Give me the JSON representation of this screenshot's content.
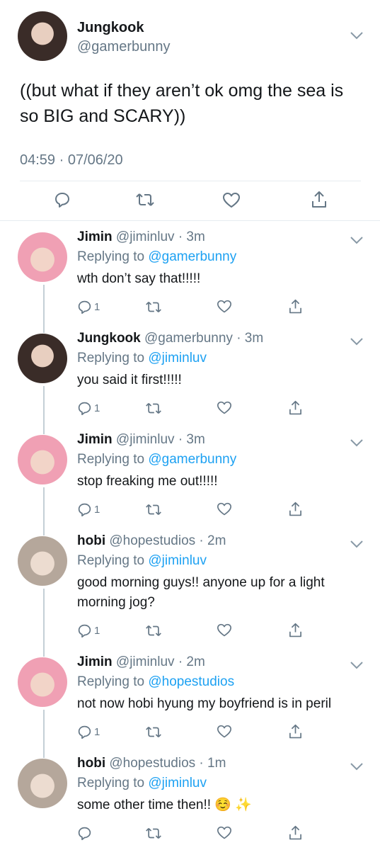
{
  "main": {
    "name": "Jungkook",
    "handle": "@gamerbunny",
    "text": "((but what if they aren’t ok omg the sea is so BIG and SCARY))",
    "timestamp": "04:59 · 07/06/20"
  },
  "replies": [
    {
      "name": "Jimin",
      "meta": "@jiminluv · 3m",
      "replying_prefix": "Replying to",
      "mention": "@gamerbunny",
      "text": "wth don’t say that!!!!!",
      "reply_count": "1"
    },
    {
      "name": "Jungkook",
      "meta": "@gamerbunny · 3m",
      "replying_prefix": "Replying to",
      "mention": "@jiminluv",
      "text": "you said it first!!!!!",
      "reply_count": "1"
    },
    {
      "name": "Jimin",
      "meta": "@jiminluv · 3m",
      "replying_prefix": "Replying to",
      "mention": "@gamerbunny",
      "text": "stop freaking me out!!!!!",
      "reply_count": "1"
    },
    {
      "name": "hobi",
      "meta": "@hopestudios · 2m",
      "replying_prefix": "Replying to",
      "mention": "@jiminluv",
      "text": "good morning guys!! anyone up for a light morning jog?",
      "reply_count": "1"
    },
    {
      "name": "Jimin",
      "meta": "@jiminluv · 2m",
      "replying_prefix": "Replying to",
      "mention": "@hopestudios",
      "text": "not now hobi hyung my boyfriend is in peril",
      "reply_count": "1"
    },
    {
      "name": "hobi",
      "meta": "@hopestudios · 1m",
      "replying_prefix": "Replying to",
      "mention": "@jiminluv",
      "text": "some other time then!! ☺️ ✨",
      "reply_count": ""
    }
  ],
  "colors": {
    "accent": "#1da1f2",
    "muted": "#657786",
    "icon": "#657786",
    "text": "#14171a"
  },
  "icons": [
    "reply-icon",
    "retweet-icon",
    "like-icon",
    "share-icon",
    "chevron-down-icon"
  ]
}
